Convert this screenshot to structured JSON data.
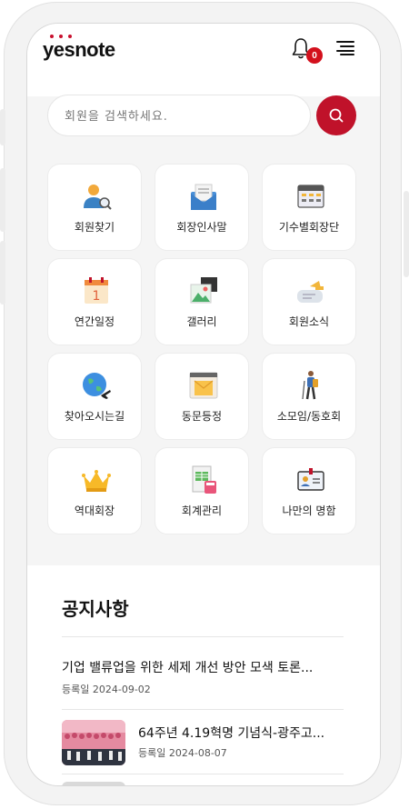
{
  "app": {
    "logo_text": "yesnote"
  },
  "header": {
    "notification_count": "0"
  },
  "search": {
    "placeholder": "회원을 검색하세요."
  },
  "menu": {
    "items": [
      {
        "label": "회원찾기",
        "icon": "member-search-icon"
      },
      {
        "label": "회장인사말",
        "icon": "greeting-letter-icon"
      },
      {
        "label": "기수별회장단",
        "icon": "roster-table-icon"
      },
      {
        "label": "연간일정",
        "icon": "calendar-icon"
      },
      {
        "label": "갤러리",
        "icon": "gallery-icon"
      },
      {
        "label": "회원소식",
        "icon": "member-news-icon"
      },
      {
        "label": "찾아오시는길",
        "icon": "globe-plane-icon"
      },
      {
        "label": "동문등정",
        "icon": "browser-doc-icon"
      },
      {
        "label": "소모임/동호회",
        "icon": "hiker-icon"
      },
      {
        "label": "역대회장",
        "icon": "crown-icon"
      },
      {
        "label": "회계관리",
        "icon": "accounting-calculator-icon"
      },
      {
        "label": "나만의 명함",
        "icon": "business-card-icon"
      }
    ]
  },
  "notices": {
    "title": "공지사항",
    "items": [
      {
        "title": "기업 밸류업을 위한 세제 개선 방안 모색 토론...",
        "date": "등록일 2024-09-02"
      },
      {
        "title": "64주년 4.19혁명 기념식-광주고...",
        "date": "등록일 2024-08-07"
      }
    ]
  },
  "colors": {
    "accent": "#c0122a",
    "badge": "#d3101c"
  }
}
